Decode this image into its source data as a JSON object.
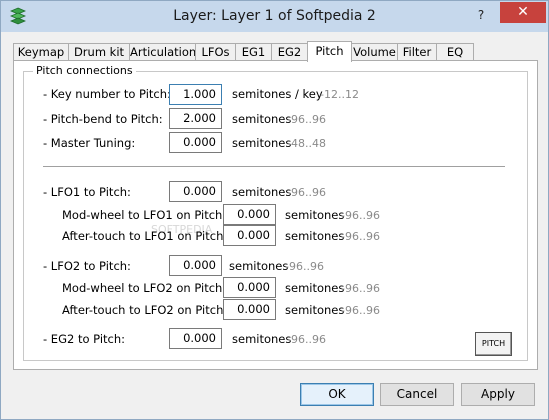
{
  "window": {
    "title": "Layer: Layer 1 of Softpedia 2",
    "help": "?",
    "close": "✕"
  },
  "tabs": [
    {
      "label": "Keymap"
    },
    {
      "label": "Drum kit"
    },
    {
      "label": "Articulation"
    },
    {
      "label": "LFOs"
    },
    {
      "label": "EG1"
    },
    {
      "label": "EG2"
    },
    {
      "label": "Pitch",
      "active": true
    },
    {
      "label": "Volume"
    },
    {
      "label": "Filter"
    },
    {
      "label": "EQ"
    }
  ],
  "group": {
    "title": "Pitch connections"
  },
  "rows": {
    "key_number": {
      "label": "- Key number to Pitch:",
      "value": "1.000",
      "unit": "semitones / key",
      "range": "-12..12"
    },
    "pitch_bend": {
      "label": "- Pitch-bend to Pitch:",
      "value": "2.000",
      "unit": "semitones",
      "range": "-96..96"
    },
    "master_tuning": {
      "label": "- Master Tuning:",
      "value": "0.000",
      "unit": "semitones",
      "range": "-48..48"
    },
    "lfo1": {
      "label": "- LFO1 to Pitch:",
      "value": "0.000",
      "unit": "semitones",
      "range": "-96..96"
    },
    "mod_lfo1": {
      "label": "Mod-wheel to LFO1 on Pitch:",
      "value": "0.000",
      "unit": "semitones",
      "range": "-96..96"
    },
    "after_lfo1": {
      "label": "After-touch to LFO1 on Pitch:",
      "value": "0.000",
      "unit": "semitones",
      "range": "-96..96"
    },
    "lfo2": {
      "label": "- LFO2 to Pitch:",
      "value": "0.000",
      "unit": "semitones",
      "range": "-96..96"
    },
    "mod_lfo2": {
      "label": "Mod-wheel to LFO2 on Pitch:",
      "value": "0.000",
      "unit": "semitones",
      "range": "-96..96"
    },
    "after_lfo2": {
      "label": "After-touch to LFO2 on Pitch:",
      "value": "0.000",
      "unit": "semitones",
      "range": "-96..96"
    },
    "eg2": {
      "label": "- EG2 to Pitch:",
      "value": "0.000",
      "unit": "semitones",
      "range": "-96..96"
    }
  },
  "watermark": "SOFTPEDIA",
  "pitch_button": "PITCH",
  "buttons": {
    "ok": "OK",
    "cancel": "Cancel",
    "apply": "Apply"
  },
  "colors": {
    "titlebar": "#c6d8ec",
    "close": "#c7423d",
    "range_text": "#8a8a8a"
  },
  "icons": {
    "app": "stacked-layers-icon"
  }
}
